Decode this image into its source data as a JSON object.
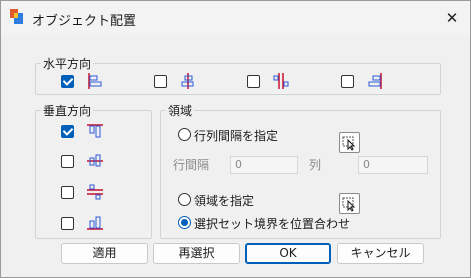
{
  "window": {
    "title": "オブジェクト配置",
    "close_glyph": "✕"
  },
  "horizontal": {
    "title": "水平方向",
    "options": [
      {
        "checked": true,
        "icon": "align-left-icon"
      },
      {
        "checked": false,
        "icon": "align-center-icon"
      },
      {
        "checked": false,
        "icon": "align-center-gap-icon"
      },
      {
        "checked": false,
        "icon": "align-right-icon"
      }
    ]
  },
  "vertical": {
    "title": "垂直方向",
    "options": [
      {
        "checked": true,
        "icon": "align-top-icon"
      },
      {
        "checked": false,
        "icon": "align-middle-icon"
      },
      {
        "checked": false,
        "icon": "align-middle-gap-icon"
      },
      {
        "checked": false,
        "icon": "align-bottom-icon"
      }
    ]
  },
  "region": {
    "title": "領域",
    "spacing_radio_label": "行列間隔を指定",
    "row_spacing_label": "行間隔",
    "row_spacing_value": "0",
    "col_label": "列",
    "col_value": "0",
    "region_radio_label": "領域を指定",
    "fit_radio_label": "選択セット境界を位置合わせ",
    "selected": "fit"
  },
  "buttons": {
    "apply": "適用",
    "reselect": "再選択",
    "ok": "OK",
    "cancel": "キャンセル"
  },
  "colors": {
    "accent": "#005fb8",
    "icon_red": "#c8102e",
    "icon_blue": "#2b57d6"
  }
}
